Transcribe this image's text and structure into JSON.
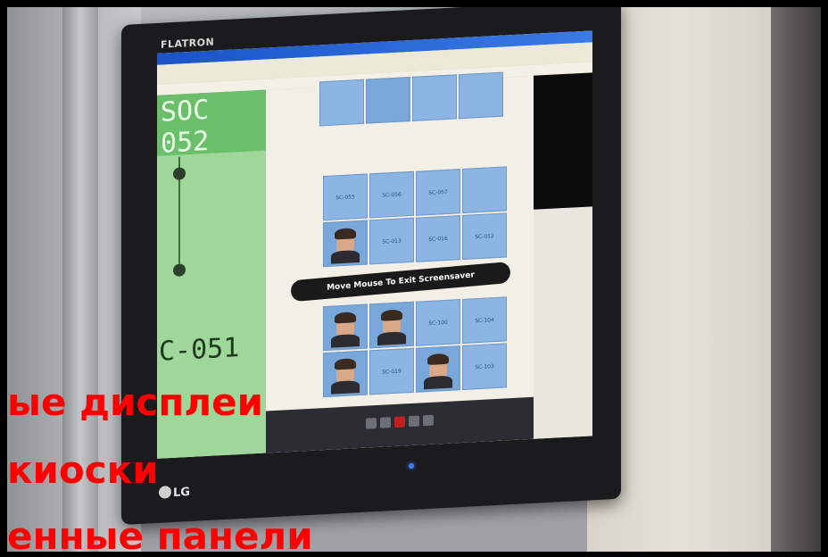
{
  "monitor": {
    "brand_top": "FLATRON",
    "brand_bottom": "LG"
  },
  "browser": {
    "title": "",
    "address": ""
  },
  "kiosk": {
    "room_code_top": "SOC 052",
    "room_code": "C-051",
    "screensaver_message": "Move Mouse To Exit Screensaver",
    "grid_top": [
      "SC-055",
      "SC-056",
      "SC-057",
      "",
      "",
      "SC-013",
      "SC-016",
      "SC-012"
    ],
    "grid_bottom": [
      "",
      "",
      "SC-100",
      "SC-104",
      "",
      "SC-019",
      "",
      "SC-103"
    ]
  },
  "overlay_lines": [
    "ые дисплеи",
    "киоски",
    "енные панели"
  ],
  "colors": {
    "overlay_text": "#ff0000",
    "kiosk_panel": "#9fd69a",
    "tile": "#8db5e3"
  }
}
